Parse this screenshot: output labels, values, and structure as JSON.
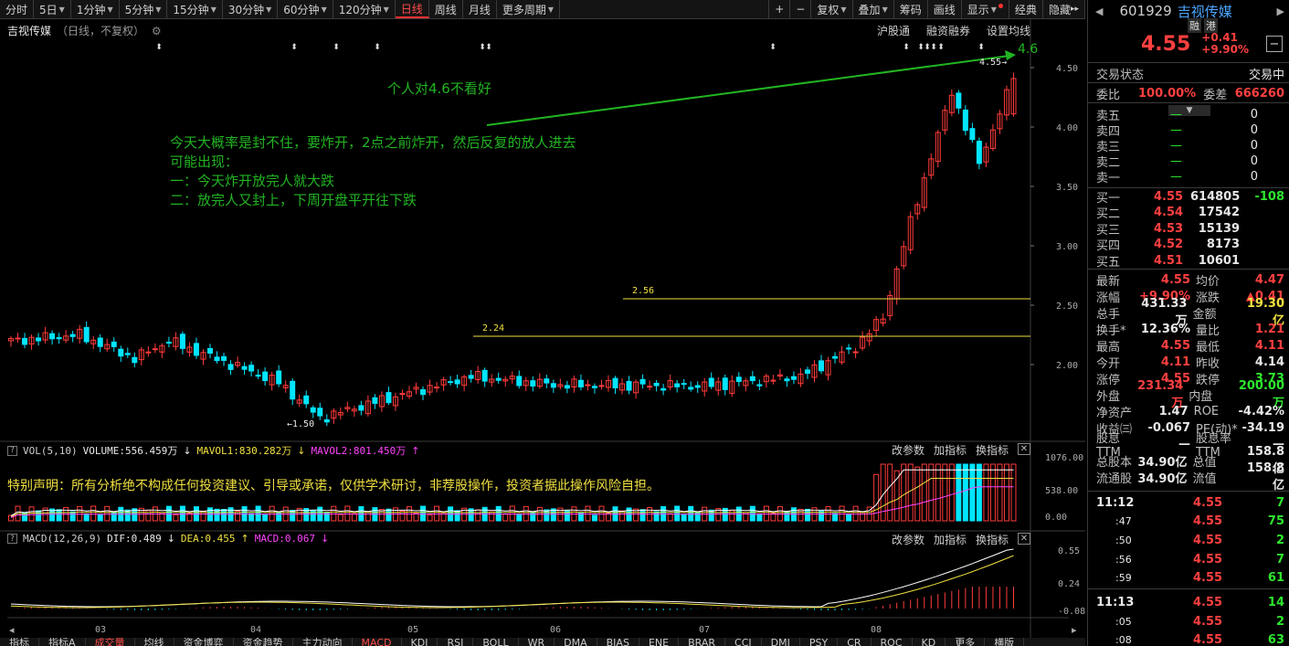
{
  "toolbar": {
    "tabs": [
      "分时",
      "5日",
      "1分钟",
      "5分钟",
      "15分钟",
      "30分钟",
      "60分钟",
      "120分钟",
      "日线",
      "周线",
      "月线",
      "更多周期"
    ],
    "active": "日线",
    "right_buttons": [
      "+",
      "−",
      "复权",
      "叠加",
      "筹码",
      "画线",
      "显示",
      "经典",
      "隐藏"
    ]
  },
  "kline": {
    "stock_name": "吉视传媒",
    "subtitle": "（日线，不复权）",
    "tools": [
      "沪股通",
      "融资融券",
      "设置均线"
    ],
    "levels": {
      "high_mark": "4.55",
      "low_mark": "1.50",
      "line_256": "2.56",
      "line_224": "2.24",
      "target": "4.6"
    },
    "y_ticks": [
      "4.50",
      "4.00",
      "3.50",
      "3.00",
      "2.50",
      "2.00"
    ],
    "annotations": {
      "top": "个人对4.6不看好",
      "line1": "今天大概率是封不住，要炸开，2点之前炸开，然后反复的放人进去",
      "line2": "可能出现：",
      "line3": "一：今天炸开放完人就大跌",
      "line4": "二：放完人又封上，下周开盘平开往下跌"
    }
  },
  "vol": {
    "label": "VOL(5,10)",
    "volume": "VOLUME:556.459万",
    "mavol1": "MAVOL1:830.282万",
    "mavol2": "MAVOL2:801.450万",
    "y_ticks": [
      "1076.00",
      "538.00",
      "0.00"
    ],
    "tools": [
      "改参数",
      "加指标",
      "换指标"
    ],
    "disclaimer": "特别声明：所有分析绝不构成任何投资建议、引导或承诺，仅供学术研讨，非荐股操作，投资者据此操作风险自担。"
  },
  "macd": {
    "label": "MACD(12,26,9)",
    "dif": "DIF:0.489",
    "dea": "DEA:0.455",
    "macd": "MACD:0.067",
    "y_ticks": [
      "0.55",
      "0.24",
      "-0.08"
    ],
    "tools": [
      "改参数",
      "加指标",
      "换指标"
    ],
    "x_ticks": [
      "03",
      "04",
      "05",
      "06",
      "07",
      "08"
    ]
  },
  "bottom_tabs": [
    "指标",
    "指标A",
    "成交量",
    "均线",
    "资金博弈",
    "资金趋势",
    "主力动向",
    "MACD",
    "KDJ",
    "RSI",
    "BOLL",
    "WR",
    "DMA",
    "BIAS",
    "ENE",
    "BRAR",
    "CCI",
    "DMI",
    "PSY",
    "CR",
    "ROC",
    "KD",
    "更多",
    "横版"
  ],
  "quote": {
    "code": "601929",
    "name": "吉视传媒",
    "badges": [
      "融",
      "港"
    ],
    "price": "4.55",
    "change": "+0.41",
    "change_pct": "+9.90%",
    "status_label": "交易状态",
    "status_value": "交易中",
    "weibi_label": "委比",
    "weibi": "100.00%",
    "weicha_label": "委差",
    "weicha": "666260",
    "sells": [
      {
        "label": "卖五",
        "price": "—",
        "vol": "0"
      },
      {
        "label": "卖四",
        "price": "—",
        "vol": "0"
      },
      {
        "label": "卖三",
        "price": "—",
        "vol": "0"
      },
      {
        "label": "卖二",
        "price": "—",
        "vol": "0"
      },
      {
        "label": "卖一",
        "price": "—",
        "vol": "0"
      }
    ],
    "buys": [
      {
        "label": "买一",
        "price": "4.55",
        "vol": "614805",
        "delta": "-108"
      },
      {
        "label": "买二",
        "price": "4.54",
        "vol": "17542",
        "delta": ""
      },
      {
        "label": "买三",
        "price": "4.53",
        "vol": "15139",
        "delta": ""
      },
      {
        "label": "买四",
        "price": "4.52",
        "vol": "8173",
        "delta": ""
      },
      {
        "label": "买五",
        "price": "4.51",
        "vol": "10601",
        "delta": ""
      }
    ],
    "stats": [
      {
        "l1": "最新",
        "v1": "4.55",
        "c1": "red",
        "l2": "均价",
        "v2": "4.47",
        "c2": "red"
      },
      {
        "l1": "涨幅",
        "v1": "+9.90%",
        "c1": "red",
        "l2": "涨跌",
        "v2": "▲0.41",
        "c2": "red"
      },
      {
        "l1": "总手",
        "v1": "431.33万",
        "c1": "white",
        "l2": "金额",
        "v2": "19.30亿",
        "c2": "yellow"
      },
      {
        "l1": "换手*",
        "v1": "12.36%",
        "c1": "white",
        "l2": "量比",
        "v2": "1.21",
        "c2": "red"
      },
      {
        "l1": "最高",
        "v1": "4.55",
        "c1": "red",
        "l2": "最低",
        "v2": "4.11",
        "c2": "red"
      },
      {
        "l1": "今开",
        "v1": "4.11",
        "c1": "red",
        "l2": "昨收",
        "v2": "4.14",
        "c2": "white"
      },
      {
        "l1": "涨停",
        "v1": "4.55",
        "c1": "red",
        "l2": "跌停",
        "v2": "3.73",
        "c2": "green"
      },
      {
        "l1": "外盘",
        "v1": "231.34万",
        "c1": "red",
        "l2": "内盘",
        "v2": "200.00万",
        "c2": "green"
      },
      {
        "l1": "净资产",
        "v1": "1.47",
        "c1": "white",
        "l2": "ROE",
        "v2": "-4.42%",
        "c2": "white"
      },
      {
        "l1": "收益㈢",
        "v1": "-0.067",
        "c1": "white",
        "l2": "PE(动)*",
        "v2": "-34.19",
        "c2": "white"
      },
      {
        "l1": "股息TTM",
        "v1": "—",
        "c1": "white",
        "l2": "股息率TTM",
        "v2": "—",
        "c2": "white"
      },
      {
        "l1": "总股本",
        "v1": "34.90亿",
        "c1": "white",
        "l2": "总值",
        "v2": "158.8亿",
        "c2": "white"
      },
      {
        "l1": "流通股",
        "v1": "34.90亿",
        "c1": "white",
        "l2": "流值",
        "v2": "158.8亿",
        "c2": "white"
      }
    ],
    "ticks": [
      {
        "time": "11:12",
        "price": "4.55",
        "vol": "7",
        "major": true
      },
      {
        "time": ":47",
        "price": "4.55",
        "vol": "75",
        "major": false
      },
      {
        "time": ":50",
        "price": "4.55",
        "vol": "2",
        "major": false
      },
      {
        "time": ":56",
        "price": "4.55",
        "vol": "7",
        "major": false
      },
      {
        "time": ":59",
        "price": "4.55",
        "vol": "61",
        "major": false
      },
      {
        "time": "11:13",
        "price": "4.55",
        "vol": "14",
        "major": true
      },
      {
        "time": ":05",
        "price": "4.55",
        "vol": "2",
        "major": false
      },
      {
        "time": ":08",
        "price": "4.55",
        "vol": "63",
        "major": false
      }
    ]
  },
  "colors": {
    "up": "#ff3b3b",
    "down": "#00e5ff",
    "ma": "#f0e040",
    "annot": "#22b422"
  }
}
